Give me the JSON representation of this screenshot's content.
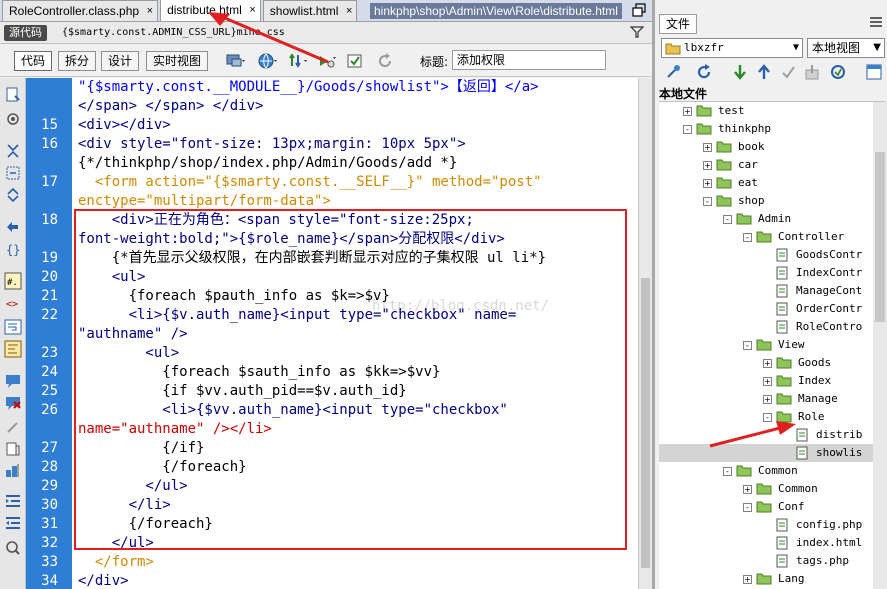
{
  "tabs": [
    {
      "label": "RoleController.class.php"
    },
    {
      "label": "distribute.html"
    },
    {
      "label": "showlist.html"
    }
  ],
  "tab_close_glyph": "×",
  "window_path": "hinkphp\\shop\\Admin\\View\\Role\\distribute.html",
  "sourcebar": {
    "source_label": "源代码",
    "path_text": "{$smarty.const.ADMIN_CSS_URL}mine.css"
  },
  "toolbar": {
    "code_label": "代码",
    "split_label": "拆分",
    "design_label": "设计",
    "live_label": "实时视图",
    "title_label": "标题:",
    "title_value": "添加权限"
  },
  "line_numbers": [
    "15",
    "16",
    "17",
    "18",
    "19",
    "20",
    "21",
    "22",
    "23",
    "24",
    "25",
    "26",
    "27",
    "28",
    "29",
    "30",
    "31",
    "32",
    "33",
    "34"
  ],
  "code_lines": [
    "\"{$smarty.const.__MODULE__}/Goods/showlist\">【返回】</a>",
    "</span> </span> </div>",
    "<div></div>",
    "<div style=\"font-size: 13px;margin: 10px 5px\">",
    "{*/thinkphp/shop/index.php/Admin/Goods/add *}",
    "  <form action=\"{$smarty.const.__SELF__}\" method=\"post\"",
    "enctype=\"multipart/form-data\">",
    "    <div>正在为角色：<span style=\"font-size:25px;",
    "font-weight:bold;\">{$role_name}</span>分配权限</div>",
    "    {*首先显示父级权限，在内部嵌套判断显示对应的子集权限 ul li*}",
    "    <ul>",
    "      {foreach $pauth_info as $k=>$v}",
    "      <li>{$v.auth_name}<input type=\"checkbox\" name=",
    "\"authname\" />",
    "        <ul>",
    "          {foreach $sauth_info as $kk=>$vv}",
    "          {if $vv.auth_pid==$v.auth_id}",
    "          <li>{$vv.auth_name}<input type=\"checkbox\"",
    "name=\"authname\" /></li>",
    "          {/if}",
    "          {/foreach}",
    "        </ul>",
    "      </li>",
    "      {/foreach}",
    "    </ul>",
    "  </form>",
    "</div>"
  ],
  "watermark": "http://blog.csdn.net/",
  "panel": {
    "tab_label": "文件",
    "site_value": "lbxzfr",
    "view_value": "本地视图",
    "local_files_label": "本地文件"
  },
  "tree": [
    {
      "label": "test",
      "kind": "folder",
      "level": 1,
      "exp": "+"
    },
    {
      "label": "thinkphp",
      "kind": "folder",
      "level": 1,
      "exp": "-"
    },
    {
      "label": "book",
      "kind": "folder",
      "level": 2,
      "exp": "+"
    },
    {
      "label": "car",
      "kind": "folder",
      "level": 2,
      "exp": "+"
    },
    {
      "label": "eat",
      "kind": "folder",
      "level": 2,
      "exp": "+"
    },
    {
      "label": "shop",
      "kind": "folder",
      "level": 2,
      "exp": "-"
    },
    {
      "label": "Admin",
      "kind": "folder",
      "level": 3,
      "exp": "-"
    },
    {
      "label": "Controller",
      "kind": "folder",
      "level": 4,
      "exp": "-"
    },
    {
      "label": "GoodsContr",
      "kind": "file",
      "level": 5
    },
    {
      "label": "IndexContr",
      "kind": "file",
      "level": 5
    },
    {
      "label": "ManageCont",
      "kind": "file",
      "level": 5
    },
    {
      "label": "OrderContr",
      "kind": "file",
      "level": 5
    },
    {
      "label": "RoleContro",
      "kind": "file",
      "level": 5
    },
    {
      "label": "View",
      "kind": "folder",
      "level": 4,
      "exp": "-"
    },
    {
      "label": "Goods",
      "kind": "folder",
      "level": 5,
      "exp": "+"
    },
    {
      "label": "Index",
      "kind": "folder",
      "level": 5,
      "exp": "+"
    },
    {
      "label": "Manage",
      "kind": "folder",
      "level": 5,
      "exp": "+"
    },
    {
      "label": "Role",
      "kind": "folder",
      "level": 5,
      "exp": "-"
    },
    {
      "label": "distrib",
      "kind": "file",
      "level": 6
    },
    {
      "label": "showlis",
      "kind": "file",
      "level": 6,
      "selected": true
    },
    {
      "label": "Common",
      "kind": "folder",
      "level": 3,
      "exp": "-"
    },
    {
      "label": "Common",
      "kind": "folder",
      "level": 4,
      "exp": "+"
    },
    {
      "label": "Conf",
      "kind": "folder",
      "level": 4,
      "exp": "-"
    },
    {
      "label": "config.php",
      "kind": "file",
      "level": 5
    },
    {
      "label": "index.html",
      "kind": "file",
      "level": 5
    },
    {
      "label": "tags.php",
      "kind": "file",
      "level": 5
    },
    {
      "label": "Lang",
      "kind": "folder",
      "level": 4,
      "exp": "+"
    }
  ],
  "colors": {
    "gutter": "#2e7ed6",
    "highlight": "#e02020",
    "tag": "#000080",
    "attr": "#d08a00",
    "string": "#0000ff"
  }
}
